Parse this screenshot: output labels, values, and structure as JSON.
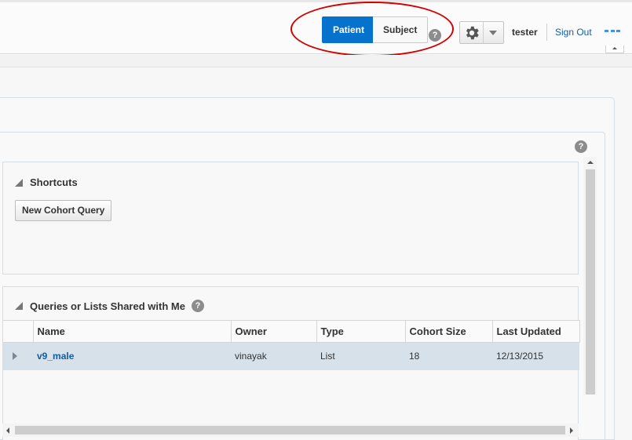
{
  "header": {
    "toggle": {
      "patient_label": "Patient",
      "subject_label": "Subject",
      "active": "Patient"
    },
    "help_glyph": "?",
    "settings_icon": "gear-icon",
    "username": "tester",
    "signout_label": "Sign Out",
    "more_icon": "more-icon"
  },
  "annotation": {
    "color": "#d20000"
  },
  "panel": {
    "help_glyph": "?"
  },
  "shortcuts": {
    "title": "Shortcuts",
    "new_cohort_label": "New Cohort Query"
  },
  "shared": {
    "title": "Queries or Lists Shared with Me",
    "help_glyph": "?",
    "columns": [
      "Name",
      "Owner",
      "Type",
      "Cohort Size",
      "Last Updated"
    ],
    "rows": [
      {
        "name": "v9_male",
        "owner": "vinayak",
        "type": "List",
        "cohort_size": "18",
        "last_updated": "12/13/2015"
      }
    ]
  },
  "colors": {
    "accent": "#0572ce",
    "link": "#145c9e",
    "selected_row": "#d6e1ea"
  }
}
